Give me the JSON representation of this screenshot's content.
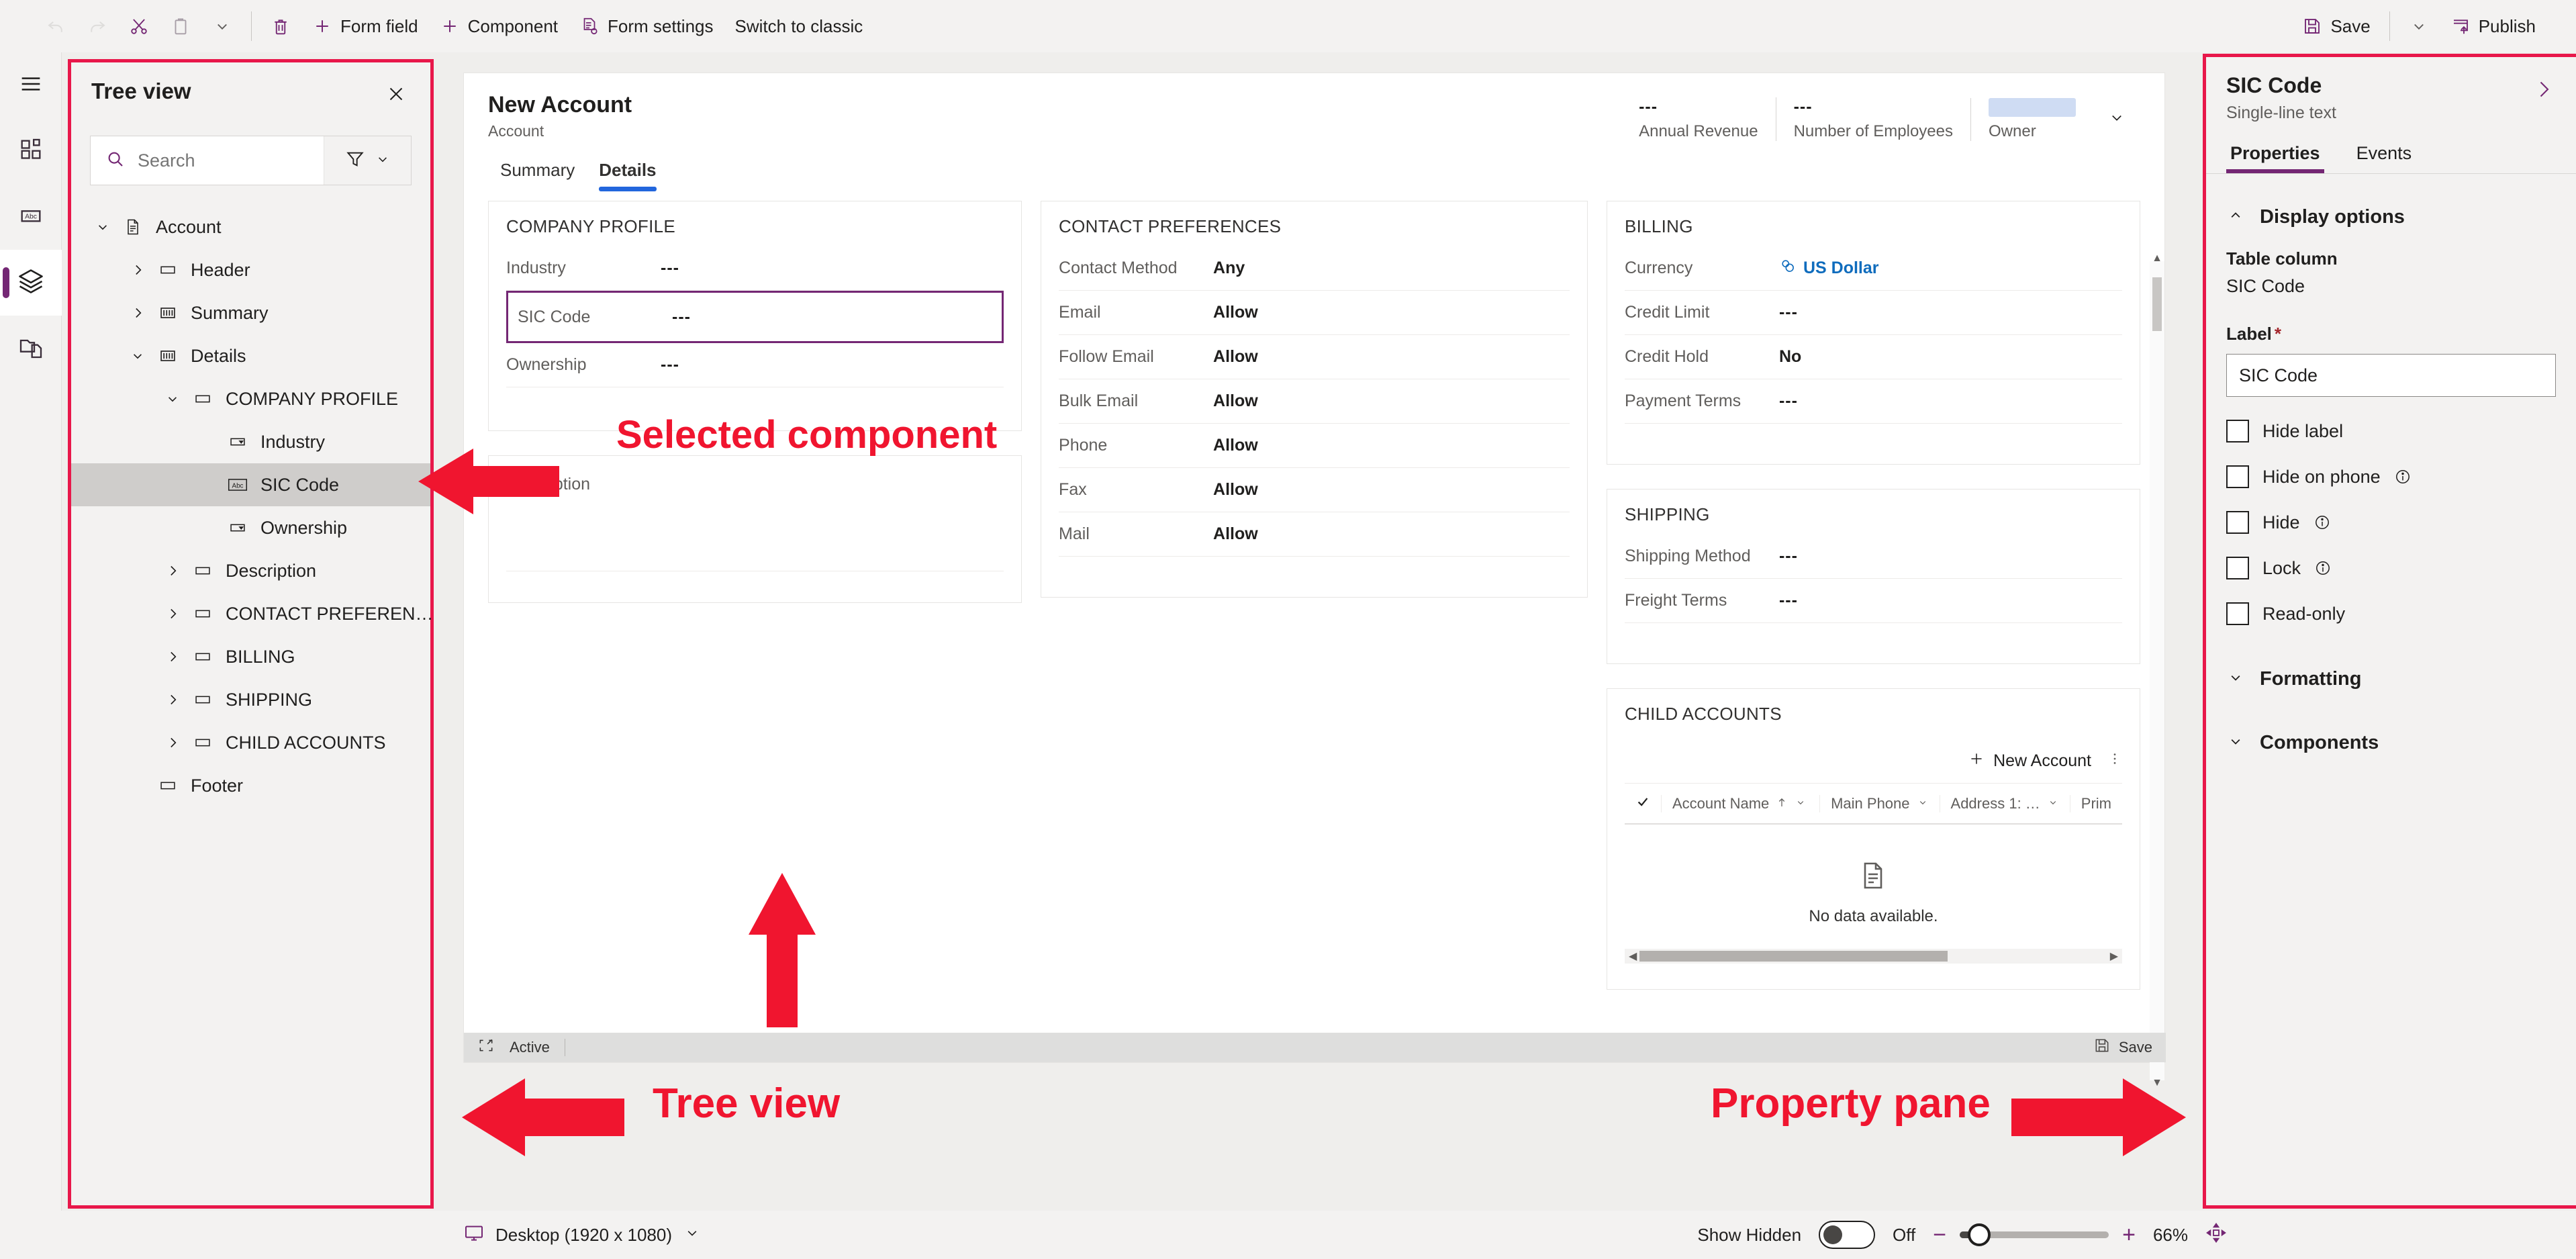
{
  "toolbar": {
    "undo_label": "Undo",
    "redo_label": "Redo",
    "cut_label": "Cut",
    "copy_label": "Copy",
    "more_label": "More",
    "delete_label": "Delete",
    "form_field_label": "Form field",
    "component_label": "Component",
    "form_settings_label": "Form settings",
    "switch_to_classic_label": "Switch to classic",
    "save_label": "Save",
    "save_chevron_label": "Save options",
    "publish_label": "Publish"
  },
  "rail": {
    "items": [
      {
        "name": "menu-icon",
        "label": "Menu"
      },
      {
        "name": "components-icon",
        "label": "Components"
      },
      {
        "name": "table-columns-icon",
        "label": "Table columns"
      },
      {
        "name": "layers-icon",
        "label": "Tree view"
      },
      {
        "name": "related-icon",
        "label": "Related forms"
      }
    ]
  },
  "treeview": {
    "title": "Tree view",
    "close_label": "Close",
    "search": {
      "placeholder": "Search",
      "value": ""
    },
    "filter_label": "Filter",
    "nodes": [
      {
        "label": "Account",
        "depth": 0,
        "chevron": "down",
        "icon": "document-icon",
        "selected": false
      },
      {
        "label": "Header",
        "depth": 1,
        "chevron": "right",
        "icon": "section-icon",
        "selected": false
      },
      {
        "label": "Summary",
        "depth": 1,
        "chevron": "right",
        "icon": "tab-icon",
        "selected": false
      },
      {
        "label": "Details",
        "depth": 1,
        "chevron": "down",
        "icon": "tab-icon",
        "selected": false
      },
      {
        "label": "COMPANY PROFILE",
        "depth": 2,
        "chevron": "down",
        "icon": "section-icon",
        "selected": false
      },
      {
        "label": "Industry",
        "depth": 3,
        "chevron": "none",
        "icon": "dropdown-icon",
        "selected": false
      },
      {
        "label": "SIC Code",
        "depth": 3,
        "chevron": "none",
        "icon": "abc-icon",
        "selected": true
      },
      {
        "label": "Ownership",
        "depth": 3,
        "chevron": "none",
        "icon": "dropdown-icon",
        "selected": false
      },
      {
        "label": "Description",
        "depth": 2,
        "chevron": "right",
        "icon": "section-icon",
        "selected": false
      },
      {
        "label": "CONTACT PREFEREN…",
        "depth": 2,
        "chevron": "right",
        "icon": "section-icon",
        "selected": false
      },
      {
        "label": "BILLING",
        "depth": 2,
        "chevron": "right",
        "icon": "section-icon",
        "selected": false
      },
      {
        "label": "SHIPPING",
        "depth": 2,
        "chevron": "right",
        "icon": "section-icon",
        "selected": false
      },
      {
        "label": "CHILD ACCOUNTS",
        "depth": 2,
        "chevron": "right",
        "icon": "section-icon",
        "selected": false
      },
      {
        "label": "Footer",
        "depth": 1,
        "chevron": "none",
        "icon": "section-icon",
        "selected": false
      }
    ]
  },
  "form": {
    "title": "New Account",
    "subtitle": "Account",
    "header_fields": [
      {
        "value": "---",
        "label": "Annual Revenue"
      },
      {
        "value": "---",
        "label": "Number of Employees"
      },
      {
        "value": "",
        "label": "Owner"
      }
    ],
    "tabs": [
      {
        "label": "Summary",
        "active": false
      },
      {
        "label": "Details",
        "active": true
      }
    ],
    "sections": {
      "company_profile": {
        "title": "COMPANY PROFILE",
        "fields": [
          {
            "label": "Industry",
            "value": "---",
            "selected": false
          },
          {
            "label": "SIC Code",
            "value": "---",
            "selected": true
          },
          {
            "label": "Ownership",
            "value": "---",
            "selected": false
          }
        ]
      },
      "description": {
        "title": "",
        "fields": [
          {
            "label": "Description",
            "value": ""
          }
        ]
      },
      "contact_preferences": {
        "title": "CONTACT PREFERENCES",
        "fields": [
          {
            "label": "Contact Method",
            "value": "Any"
          },
          {
            "label": "Email",
            "value": "Allow"
          },
          {
            "label": "Follow Email",
            "value": "Allow"
          },
          {
            "label": "Bulk Email",
            "value": "Allow"
          },
          {
            "label": "Phone",
            "value": "Allow"
          },
          {
            "label": "Fax",
            "value": "Allow"
          },
          {
            "label": "Mail",
            "value": "Allow"
          }
        ]
      },
      "billing": {
        "title": "BILLING",
        "fields": [
          {
            "label": "Currency",
            "value": "US Dollar",
            "kind": "lookup"
          },
          {
            "label": "Credit Limit",
            "value": "---"
          },
          {
            "label": "Credit Hold",
            "value": "No"
          },
          {
            "label": "Payment Terms",
            "value": "---"
          }
        ]
      },
      "shipping": {
        "title": "SHIPPING",
        "fields": [
          {
            "label": "Shipping Method",
            "value": "---"
          },
          {
            "label": "Freight Terms",
            "value": "---"
          }
        ]
      },
      "child_accounts": {
        "title": "CHILD ACCOUNTS",
        "new_button": "New Account",
        "overflow_label": "More commands",
        "columns": [
          "Account Name",
          "Main Phone",
          "Address 1: …",
          "Prim"
        ],
        "sort_column": "Account Name",
        "empty_text": "No data available."
      }
    },
    "status": {
      "state": "Active",
      "save_label": "Save"
    }
  },
  "property_pane": {
    "title": "SIC Code",
    "subtitle": "Single-line text",
    "expand_label": "Expand",
    "tabs": [
      {
        "label": "Properties",
        "active": true
      },
      {
        "label": "Events",
        "active": false
      }
    ],
    "display_options": {
      "title": "Display options",
      "table_column_label": "Table column",
      "table_column_value": "SIC Code",
      "label_field_label": "Label",
      "label_field_required": "*",
      "label_field_value": "SIC Code",
      "checkboxes": [
        {
          "label": "Hide label",
          "checked": false,
          "info": false
        },
        {
          "label": "Hide on phone",
          "checked": false,
          "info": true
        },
        {
          "label": "Hide",
          "checked": false,
          "info": true
        },
        {
          "label": "Lock",
          "checked": false,
          "info": true
        },
        {
          "label": "Read-only",
          "checked": false,
          "info": false
        }
      ]
    },
    "formatting": {
      "title": "Formatting"
    },
    "components": {
      "title": "Components"
    }
  },
  "bottom_bar": {
    "device_label": "Desktop (1920 x 1080)",
    "show_hidden_label": "Show Hidden",
    "show_hidden_state": "Off",
    "zoom_out_label": "−",
    "zoom_in_label": "+",
    "zoom_level": "66%",
    "fit_label": "Fit to screen"
  },
  "annotations": [
    {
      "text": "Selected component",
      "name": "annotation-selected-component"
    },
    {
      "text": "Tree view",
      "name": "annotation-tree-view"
    },
    {
      "text": "Property pane",
      "name": "annotation-property-pane"
    }
  ],
  "colors": {
    "accent_purple": "#742774",
    "annotation_red": "#f0152f",
    "tab_blue": "#2266dd",
    "link_blue": "#0f6cbd"
  }
}
